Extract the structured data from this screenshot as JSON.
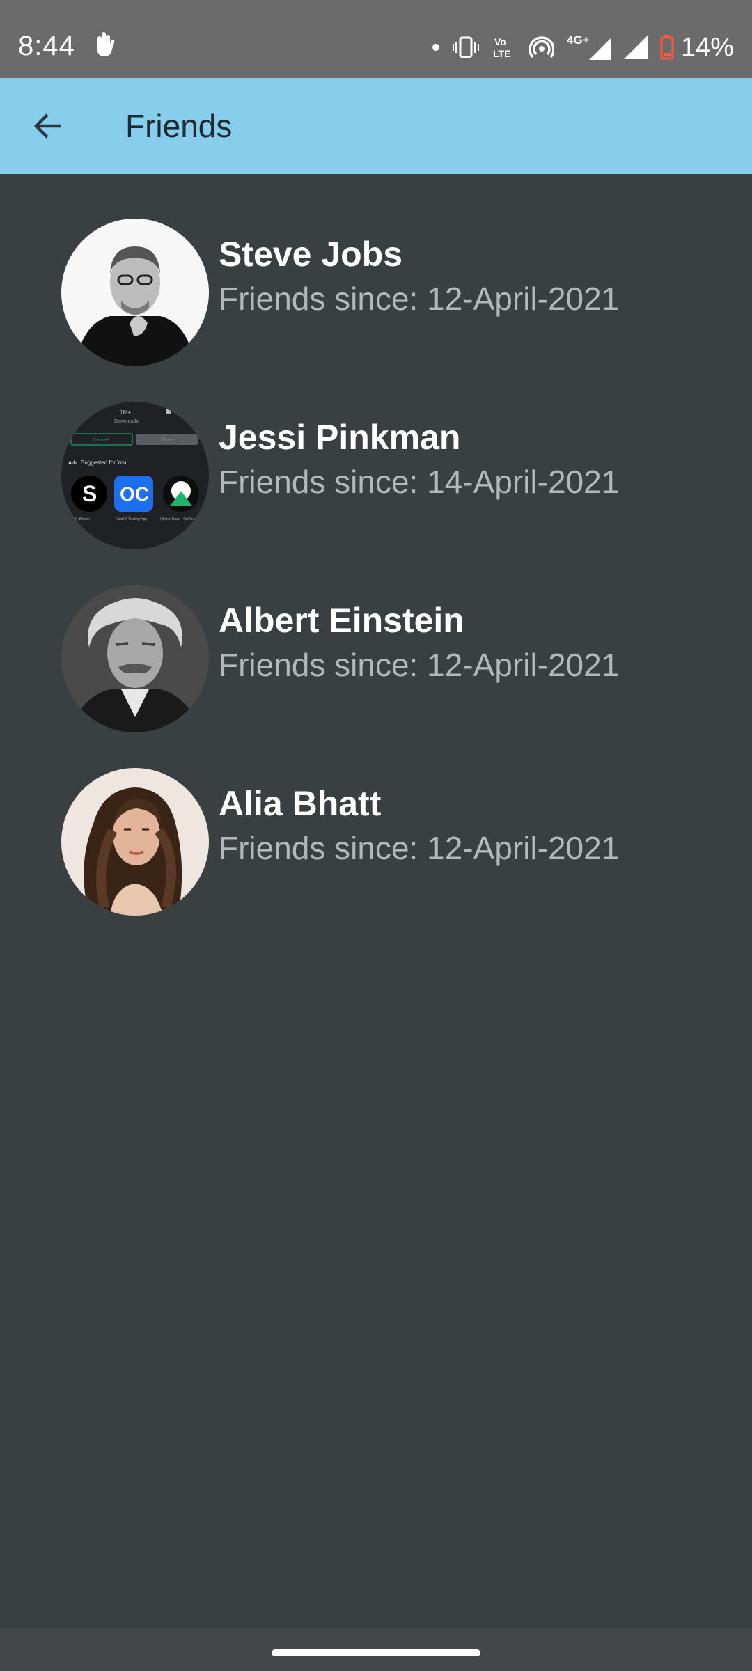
{
  "status_bar": {
    "time": "8:44",
    "battery_percent": "14%",
    "network_label": "4G+",
    "volte_top": "Vo",
    "volte_bottom": "LTE",
    "battery_color": "#ff5a3c",
    "icons": [
      "touch-gesture-icon",
      "notification-dot-icon",
      "vibrate-icon",
      "volte-icon",
      "hotspot-icon",
      "signal-icon",
      "signal-icon",
      "battery-icon"
    ]
  },
  "app_bar": {
    "title": "Friends",
    "background": "#87ceed",
    "back_icon": "arrow-left-icon"
  },
  "friends": [
    {
      "name": "Steve Jobs",
      "since": "Friends since: 12-April-2021",
      "avatar": "portrait-black-and-white"
    },
    {
      "name": "Jessi Pinkman",
      "since": "Friends since: 14-April-2021",
      "avatar": "app-store-screenshot"
    },
    {
      "name": "Albert Einstein",
      "since": "Friends since: 12-April-2021",
      "avatar": "portrait-sepia"
    },
    {
      "name": "Alia Bhatt",
      "since": "Friends since: 12-April-2021",
      "avatar": "portrait-color"
    }
  ],
  "avatar_thumb_text": {
    "downloads_count": "1M+",
    "downloads_label": "Downloads",
    "cancel": "Cancel",
    "open": "Open",
    "ads": "Ads",
    "suggested": "Suggested for You",
    "app1_name": "Switch: Bitcoin",
    "app2_name": "OctaFX Trading App",
    "app3_name": "Olymp Trade - Onl Trading App",
    "app1_glyph": "S",
    "app2_glyph": "OC"
  },
  "colors": {
    "background": "#3a3f41",
    "status_bar": "#6b6b6b",
    "name_text": "#ffffff",
    "since_text": "#b4b8ba"
  }
}
